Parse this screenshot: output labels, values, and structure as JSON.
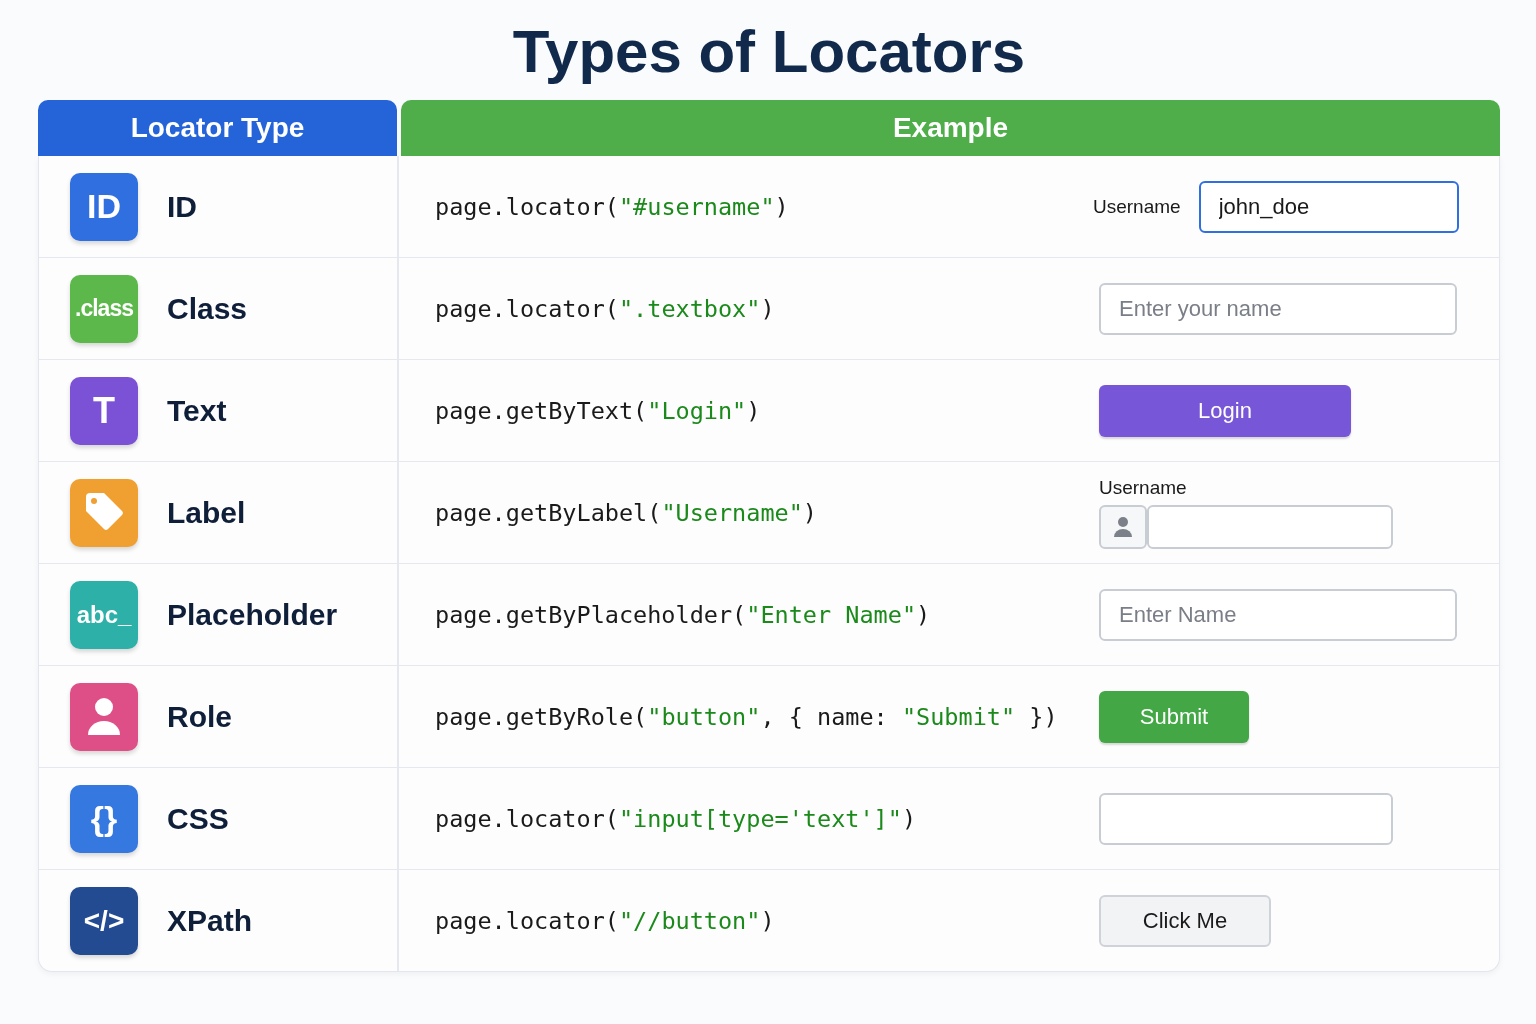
{
  "title": "Types of Locators",
  "columns": [
    {
      "label": "Locator Type",
      "color": "#2563d9"
    },
    {
      "label": "Example",
      "color": "#4fae4a"
    }
  ],
  "rows": [
    {
      "name": "ID",
      "icon": {
        "kind": "text",
        "glyph": "ID",
        "color": "#2f6fe0"
      },
      "code": [
        {
          "kind": "plain",
          "text": "page.locator("
        },
        {
          "kind": "string",
          "text": "\"#username\""
        },
        {
          "kind": "plain",
          "text": ")"
        }
      ],
      "demo": {
        "kind": "labeled-input",
        "label": "Username",
        "value": "john_doe",
        "focused": true
      }
    },
    {
      "name": "Class",
      "icon": {
        "kind": "text",
        "glyph": ".class",
        "color": "#5cb84a"
      },
      "code": [
        {
          "kind": "plain",
          "text": "page.locator("
        },
        {
          "kind": "string",
          "text": "\".textbox\""
        },
        {
          "kind": "plain",
          "text": ")"
        }
      ],
      "demo": {
        "kind": "input",
        "placeholder": "Enter your name"
      }
    },
    {
      "name": "Text",
      "icon": {
        "kind": "text",
        "glyph": "T",
        "color": "#7b52d6"
      },
      "code": [
        {
          "kind": "plain",
          "text": "page.getByText("
        },
        {
          "kind": "string",
          "text": "\"Login\""
        },
        {
          "kind": "plain",
          "text": ")"
        }
      ],
      "demo": {
        "kind": "button",
        "label": "Login",
        "color": "#7756d8"
      }
    },
    {
      "name": "Label",
      "icon": {
        "kind": "tag",
        "color": "#f0a030"
      },
      "code": [
        {
          "kind": "plain",
          "text": "page.getByLabel("
        },
        {
          "kind": "string",
          "text": "\"Username\""
        },
        {
          "kind": "plain",
          "text": ")"
        }
      ],
      "demo": {
        "kind": "icon-input",
        "label": "Username"
      }
    },
    {
      "name": "Placeholder",
      "icon": {
        "kind": "text",
        "glyph": "abc_",
        "color": "#2cb0a8"
      },
      "code": [
        {
          "kind": "plain",
          "text": "page.getByPlaceholder("
        },
        {
          "kind": "string",
          "text": "\"Enter Name\""
        },
        {
          "kind": "plain",
          "text": ")"
        }
      ],
      "demo": {
        "kind": "input",
        "placeholder": "Enter Name"
      }
    },
    {
      "name": "Role",
      "icon": {
        "kind": "person",
        "color": "#de4f88"
      },
      "code": [
        {
          "kind": "plain",
          "text": "page.getByRole("
        },
        {
          "kind": "string",
          "text": "\"button\""
        },
        {
          "kind": "plain",
          "text": ", { name: "
        },
        {
          "kind": "string",
          "text": "\"Submit\""
        },
        {
          "kind": "plain",
          "text": " })"
        }
      ],
      "demo": {
        "kind": "button",
        "label": "Submit",
        "color": "#44a746"
      }
    },
    {
      "name": "CSS",
      "icon": {
        "kind": "text",
        "glyph": "{}",
        "color": "#3478e0"
      },
      "code": [
        {
          "kind": "plain",
          "text": "page.locator("
        },
        {
          "kind": "string",
          "text": "\"input[type='text']\""
        },
        {
          "kind": "plain",
          "text": ")"
        }
      ],
      "demo": {
        "kind": "empty-input"
      }
    },
    {
      "name": "XPath",
      "icon": {
        "kind": "text",
        "glyph": "</>",
        "color": "#224b92"
      },
      "code": [
        {
          "kind": "plain",
          "text": "page.locator("
        },
        {
          "kind": "string",
          "text": "\"//button\""
        },
        {
          "kind": "plain",
          "text": ")"
        }
      ],
      "demo": {
        "kind": "plain-button",
        "label": "Click Me"
      }
    }
  ]
}
